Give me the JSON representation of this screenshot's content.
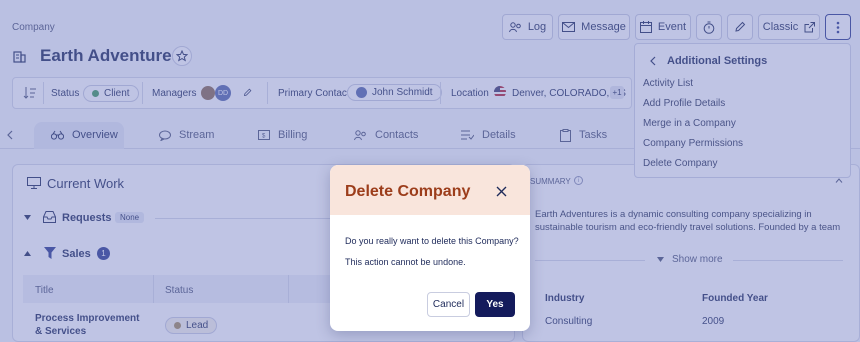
{
  "breadcrumb": "Company",
  "company": {
    "name": "Earth Adventures"
  },
  "toolbar": {
    "log": "Log",
    "message": "Message",
    "event": "Event",
    "classic": "Classic"
  },
  "info_bar": {
    "status_label": "Status",
    "status_value": "Client",
    "status_color": "#3d9a5b",
    "managers_label": "Managers",
    "manager_initials": "DD",
    "primary_contact_label": "Primary Contact",
    "primary_contact_value": "John Schmidt",
    "location_label": "Location",
    "location_value": "Denver, COLORADO, US",
    "location_extra": "+1"
  },
  "tabs": [
    "Overview",
    "Stream",
    "Billing",
    "Contacts",
    "Details",
    "Tasks"
  ],
  "current_work": {
    "title": "Current Work",
    "requests_label": "Requests",
    "requests_badge": "None",
    "sales_label": "Sales",
    "sales_count": "1",
    "table_headers": [
      "Title",
      "Status"
    ],
    "rows": [
      {
        "title": "Process Improvement & Services",
        "status": "Lead"
      }
    ]
  },
  "summary": {
    "title": "SUMMARY",
    "text": "Earth Adventures is a dynamic consulting company specializing in sustainable tourism and eco-friendly travel solutions. Founded by a team of...",
    "show_more": "Show more",
    "industry_label": "Industry",
    "industry_value": "Consulting",
    "founded_label": "Founded Year",
    "founded_value": "2009"
  },
  "menu": {
    "title": "Additional Settings",
    "items": [
      "Activity List",
      "Add Profile Details",
      "Merge in a Company",
      "Company Permissions",
      "Delete Company"
    ]
  },
  "modal": {
    "title": "Delete Company",
    "question": "Do you really want to delete this Company?",
    "warning": "This action cannot be undone.",
    "cancel": "Cancel",
    "confirm": "Yes"
  }
}
